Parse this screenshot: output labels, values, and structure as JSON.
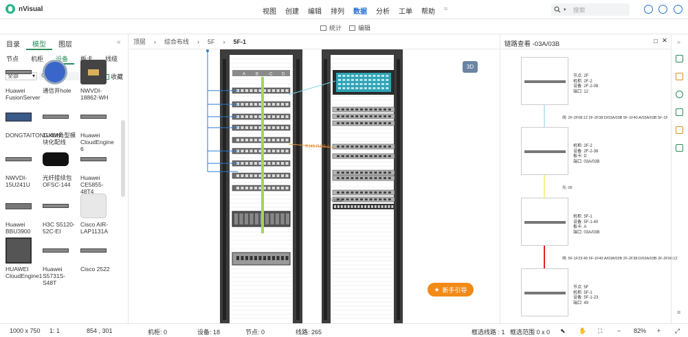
{
  "app": {
    "name": "nVisual"
  },
  "menu": [
    "视图",
    "创建",
    "编辑",
    "排列",
    "数据",
    "分析",
    "工单",
    "帮助"
  ],
  "menu_active_index": 4,
  "search": {
    "placeholder": "搜索"
  },
  "toolbar": {
    "stats": "统计",
    "edit": "编辑"
  },
  "left": {
    "tabs": [
      "目录",
      "模型",
      "图层"
    ],
    "active_tab": "模型",
    "subtabs": [
      "节点",
      "机柜",
      "设备",
      "板卡",
      "线缆"
    ],
    "active_subtab": "设备",
    "filter_value": "全部",
    "collect_label": "收藏",
    "devices": [
      {
        "label": "Huawei FusionServer",
        "icon": "server-1u-icon"
      },
      {
        "label": "通信井hole",
        "icon": "manhole-icon"
      },
      {
        "label": "NWVDI-18862-WH",
        "icon": "wall-socket-icon"
      },
      {
        "label": "DONGTAITONGXUN",
        "icon": "network-switch-icon"
      },
      {
        "label": "1U4M角型模块化配线",
        "icon": "patch-panel-icon"
      },
      {
        "label": "Huawei CloudEngine 6",
        "icon": "switch-icon"
      },
      {
        "label": "NWVDI-15U241U",
        "icon": "patch-panel-icon"
      },
      {
        "label": "光纤接续包OFSC-144",
        "icon": "fiber-closure-icon"
      },
      {
        "label": "Huawei CE5855-48T4",
        "icon": "switch-icon"
      },
      {
        "label": "Huawei BBU3900",
        "icon": "bbu-icon"
      },
      {
        "label": "H3C S5120-52C-EI",
        "icon": "switch-icon"
      },
      {
        "label": "Cisco AIR-LAP1131A",
        "icon": "access-point-icon"
      },
      {
        "label": "HUAWEI CloudEngine1",
        "icon": "chassis-icon"
      },
      {
        "label": "Huawei S5731S-S48T",
        "icon": "switch-icon"
      },
      {
        "label": "Cisco 2522",
        "icon": "router-icon"
      }
    ]
  },
  "breadcrumb": [
    "顶层",
    "综合布线",
    "5F",
    "5F-1"
  ],
  "canvas": {
    "btn_3d": "3D",
    "port_labels": [
      "A",
      "B",
      "C",
      "D"
    ],
    "link_label": "RJ45-RJ45-1",
    "link_label2": "F-1818",
    "guide_label": "新手引导"
  },
  "right": {
    "title": "链路查看 -03A/03B",
    "nodes": [
      {
        "lines": [
          "节点: 2F",
          "机柜: 2F-2",
          "设备: 2F-2-08",
          "端口: 12"
        ]
      },
      {
        "lines": [
          "机柜: 2F-2",
          "设备: 2F-2-38",
          "板卡: D",
          "端口: 03A/03B"
        ]
      },
      {
        "lines": [
          "机柜: 5F-1",
          "设备: 5F-1-40",
          "板卡: A",
          "端口: 03A/03B"
        ]
      },
      {
        "lines": [
          "节点: 5F",
          "机柜: 5F-1",
          "设备: 5F-1-23",
          "端口: 49"
        ]
      }
    ],
    "link_texts": [
      "线: 2F-2F08:12 2F-2F38:D/03A/03B 5F-1F40:A/03A/03B 5F-1F",
      "光: 05",
      "线: 5F-1F23:49 5F-1F40:A/03A/03B 2F-2F38:D/03A/03B 2F-2F08:12"
    ],
    "colors": {
      "top_link": "#7fd3e6",
      "mid_link": "#f5e74a",
      "bottom_link": "#e02020"
    }
  },
  "status": {
    "canvas_size": "1000 x 750",
    "scale": "1: 1",
    "coords": "854 , 301",
    "cabinets": "机柜: 0",
    "devices": "设备: 18",
    "nodes": "节点: 0",
    "lines": "线路: 265",
    "selected_lines": "框选线路 : 1",
    "selected_range": "框选范围 0 x 0",
    "zoom": "82%"
  }
}
